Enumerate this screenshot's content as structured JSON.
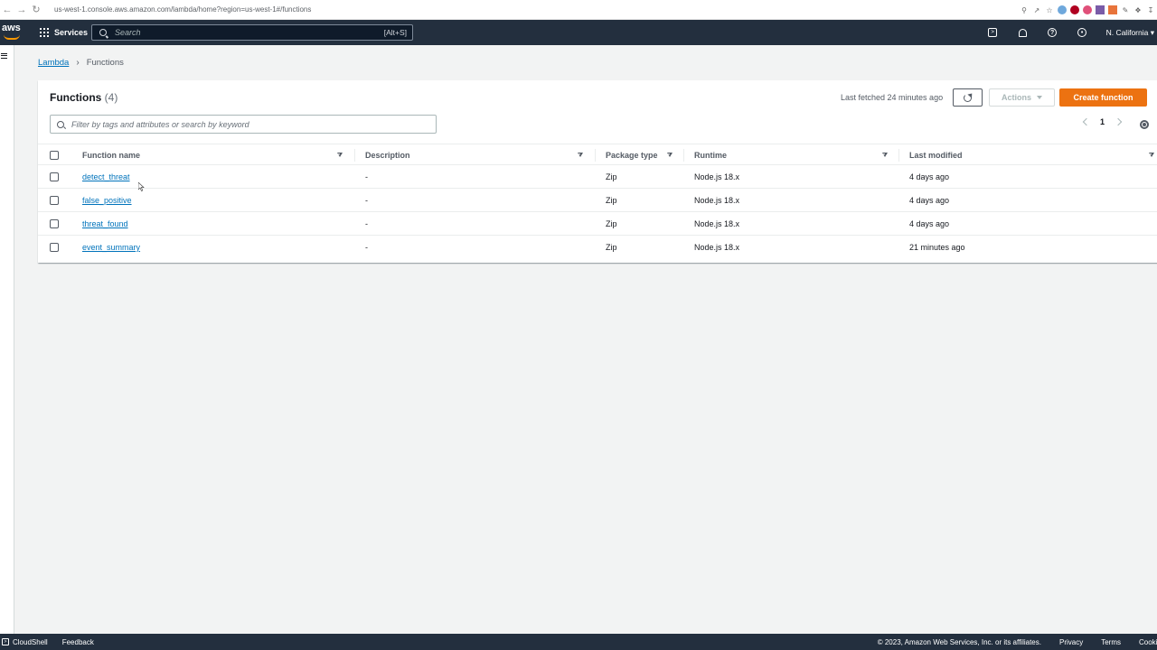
{
  "browser": {
    "url": "us-west-1.console.aws.amazon.com/lambda/home?region=us-west-1#/functions"
  },
  "topnav": {
    "services_label": "Services",
    "search_placeholder": "Search",
    "search_shortcut": "[Alt+S]",
    "region": "N. California"
  },
  "breadcrumb": {
    "root": "Lambda",
    "current": "Functions"
  },
  "functions_panel": {
    "title": "Functions",
    "count": "(4)",
    "last_fetched": "Last fetched 24 minutes ago",
    "actions_label": "Actions",
    "create_label": "Create function",
    "filter_placeholder": "Filter by tags and attributes or search by keyword",
    "page_number": "1"
  },
  "table": {
    "columns": [
      "Function name",
      "Description",
      "Package type",
      "Runtime",
      "Last modified"
    ],
    "rows": [
      {
        "name": "detect_threat",
        "description": "-",
        "package_type": "Zip",
        "runtime": "Node.js 18.x",
        "last_modified": "4 days ago"
      },
      {
        "name": "false_positive",
        "description": "-",
        "package_type": "Zip",
        "runtime": "Node.js 18.x",
        "last_modified": "4 days ago"
      },
      {
        "name": "threat_found",
        "description": "-",
        "package_type": "Zip",
        "runtime": "Node.js 18.x",
        "last_modified": "4 days ago"
      },
      {
        "name": "event_summary",
        "description": "-",
        "package_type": "Zip",
        "runtime": "Node.js 18.x",
        "last_modified": "21 minutes ago"
      }
    ]
  },
  "footer": {
    "cloudshell": "CloudShell",
    "feedback": "Feedback",
    "copyright": "© 2023, Amazon Web Services, Inc. or its affiliates.",
    "privacy": "Privacy",
    "terms": "Terms",
    "cookies": "Cookie preferences"
  },
  "colors": {
    "aws_nav": "#232f3e",
    "link": "#0073bb",
    "primary_button": "#ec7211",
    "page_bg": "#f2f3f3"
  }
}
